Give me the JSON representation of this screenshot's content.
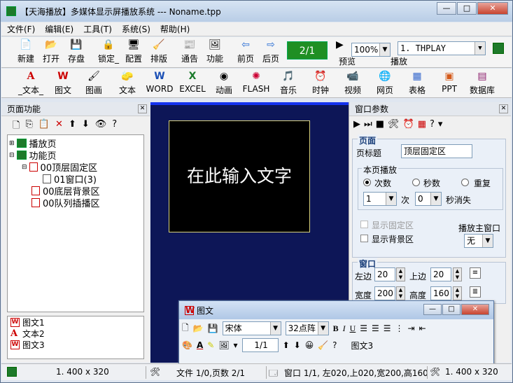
{
  "window": {
    "title": "【天海播放】多媒体显示屏播放系统 --- Noname.tpp",
    "minimize": "—",
    "maximize": "□",
    "close": "✕"
  },
  "menu": [
    "文件(F)",
    "编辑(E)",
    "工具(T)",
    "系统(S)",
    "帮助(H)"
  ],
  "toolbar1": {
    "buttons": [
      "新建",
      "打开",
      "存盘",
      "锁定_",
      "配置",
      "排版",
      "通告",
      "功能",
      "前页",
      "后页"
    ],
    "page_indicator": "2/1",
    "preview_label": "预览",
    "zoom_value": "100%",
    "play_combo_value": "1. THPLAY",
    "play_label": "播放"
  },
  "toolbar2": {
    "buttons": [
      "_文本_",
      "图文",
      "图画",
      "文本",
      "WORD",
      "EXCEL",
      "动画",
      "FLASH",
      "音乐",
      "时钟",
      "视频",
      "网页",
      "表格",
      "PPT",
      "数据库"
    ]
  },
  "left_panel": {
    "title": "页面功能",
    "tree": [
      "播放页",
      "功能页",
      "00顶层固定区",
      "01窗口(3)",
      "00底层背景区",
      "00队列插播区"
    ],
    "list": [
      {
        "icon": "W",
        "label": "图文1"
      },
      {
        "icon": "A",
        "label": "文本2"
      },
      {
        "icon": "W",
        "label": "图文3"
      }
    ]
  },
  "canvas": {
    "text": "在此输入文字"
  },
  "right_panel": {
    "title": "窗口参数",
    "page_group": {
      "title": "页面",
      "page_title_label": "页标题",
      "page_title_value": "顶层固定区"
    },
    "play_group": {
      "title": "本页播放",
      "radio_times": "次数",
      "radio_seconds": "秒数",
      "radio_repeat": "重复",
      "times_value": "1",
      "times_unit": "次",
      "seconds_value": "0",
      "seconds_suffix": "秒消失"
    },
    "show_fixed": "显示固定区",
    "show_bg": "显示背景区",
    "main_window_label": "播放主窗口",
    "main_window_value": "无",
    "window_group": {
      "title": "窗口",
      "left_label": "左边",
      "left_value": "20",
      "top_label": "上边",
      "top_value": "20",
      "width_label": "宽度",
      "width_value": "200",
      "height_label": "高度",
      "height_value": "160"
    }
  },
  "popup": {
    "title": "图文",
    "font": "宋体",
    "size": "32点阵",
    "page": "1/1",
    "item": "图文3"
  },
  "status": {
    "s1": "1. 400 x 320",
    "s2": "文件 1/0,页数 2/1",
    "s3": "窗口 1/1, 左020,上020,宽200,高160",
    "s4": "1. 400 x 320"
  },
  "icons": {
    "bold": "B",
    "italic": "I",
    "underline": "U"
  }
}
